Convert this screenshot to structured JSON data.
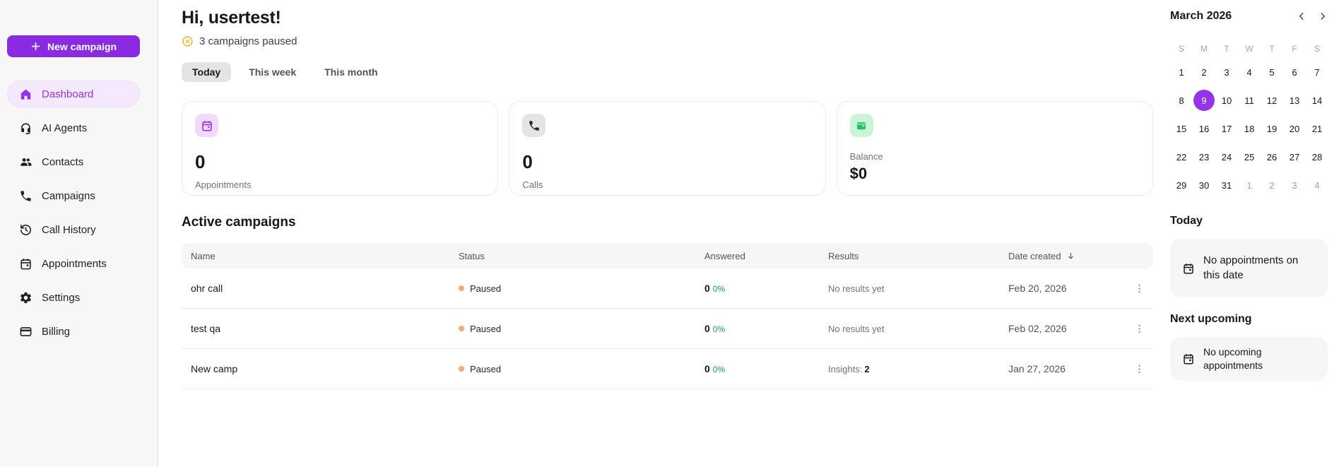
{
  "sidebar": {
    "new_campaign_label": "New campaign",
    "items": [
      {
        "label": "Dashboard",
        "icon": "home-icon",
        "active": true
      },
      {
        "label": "AI Agents",
        "icon": "headset-icon"
      },
      {
        "label": "Contacts",
        "icon": "contacts-icon"
      },
      {
        "label": "Campaigns",
        "icon": "phone-icon"
      },
      {
        "label": "Call History",
        "icon": "history-icon"
      },
      {
        "label": "Appointments",
        "icon": "calendar-icon"
      },
      {
        "label": "Settings",
        "icon": "gear-icon"
      },
      {
        "label": "Billing",
        "icon": "billing-card-icon"
      }
    ]
  },
  "header": {
    "greeting": "Hi, usertest!",
    "paused_notice": "3 campaigns paused"
  },
  "tabs": {
    "items": [
      {
        "label": "Today",
        "active": true
      },
      {
        "label": "This week",
        "active": false
      },
      {
        "label": "This month",
        "active": false
      }
    ]
  },
  "stats": {
    "cards": [
      {
        "value": "0",
        "label": "Appointments",
        "icon": "calendar-icon",
        "accent": "#a43be8"
      },
      {
        "value": "0",
        "label": "Calls",
        "icon": "phone-icon",
        "accent": "#232326"
      },
      {
        "label": "Balance",
        "value": "$0",
        "icon": "wallet-icon",
        "accent": "#25c169"
      }
    ]
  },
  "campaigns": {
    "title": "Active campaigns",
    "columns": [
      "Name",
      "Status",
      "Answered",
      "Results",
      "Date created"
    ],
    "sorted_by": "Date created",
    "rows": [
      {
        "name": "ohr call",
        "status": "Paused",
        "answered": "0",
        "answered_pct": "0%",
        "results": "No results yet",
        "date": "Feb 20, 2026"
      },
      {
        "name": "test qa",
        "status": "Paused",
        "answered": "0",
        "answered_pct": "0%",
        "results": "No results yet",
        "date": "Feb 02, 2026"
      },
      {
        "name": "New camp",
        "status": "Paused",
        "answered": "0",
        "answered_pct": "0%",
        "results": "Insights:",
        "results_strong": "2",
        "date": "Jan 27, 2026"
      }
    ]
  },
  "calendar": {
    "month": "March 2026",
    "weekdays": [
      "S",
      "M",
      "T",
      "W",
      "T",
      "F",
      "S"
    ],
    "selected_day": "9",
    "days": [
      {
        "d": "1"
      },
      {
        "d": "2"
      },
      {
        "d": "3"
      },
      {
        "d": "4"
      },
      {
        "d": "5"
      },
      {
        "d": "6"
      },
      {
        "d": "7"
      },
      {
        "d": "8"
      },
      {
        "d": "9",
        "selected": true
      },
      {
        "d": "10"
      },
      {
        "d": "11"
      },
      {
        "d": "12"
      },
      {
        "d": "13"
      },
      {
        "d": "14"
      },
      {
        "d": "15"
      },
      {
        "d": "16"
      },
      {
        "d": "17"
      },
      {
        "d": "18"
      },
      {
        "d": "19"
      },
      {
        "d": "20"
      },
      {
        "d": "21"
      },
      {
        "d": "22"
      },
      {
        "d": "23"
      },
      {
        "d": "24"
      },
      {
        "d": "25"
      },
      {
        "d": "26"
      },
      {
        "d": "27"
      },
      {
        "d": "28"
      },
      {
        "d": "29"
      },
      {
        "d": "30"
      },
      {
        "d": "31"
      },
      {
        "d": "1",
        "muted": true
      },
      {
        "d": "2",
        "muted": true
      },
      {
        "d": "3",
        "muted": true
      },
      {
        "d": "4",
        "muted": true
      }
    ]
  },
  "panel": {
    "today_title": "Today",
    "today_empty": "No appointments on this date",
    "upcoming_title": "Next upcoming",
    "upcoming_empty": "No upcoming appointments"
  },
  "colors": {
    "accent_purple": "#8a2be2",
    "nav_active_purple": "#9333ea",
    "selected_day_purple": "#9333ea",
    "warning_amber": "#f0b429",
    "paused_dot": "#f9a877",
    "positive_green": "#16a34a",
    "balance_green": "#25c169"
  }
}
